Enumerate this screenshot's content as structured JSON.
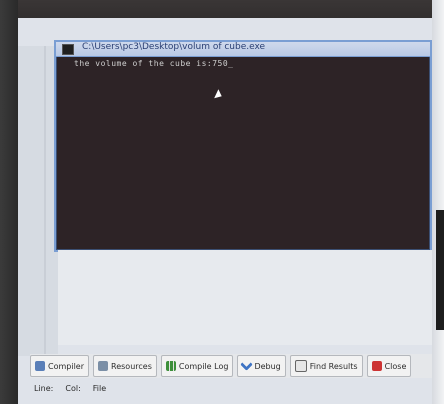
{
  "console": {
    "title": "C:\\Users\\pc3\\Desktop\\volum of cube.exe",
    "output": "the volume of the cube is:750_"
  },
  "tabs": [
    {
      "label": "Compiler",
      "icon": "compiler-icon"
    },
    {
      "label": "Resources",
      "icon": "resources-icon"
    },
    {
      "label": "Compile Log",
      "icon": "compile-log-icon"
    },
    {
      "label": "Debug",
      "icon": "debug-icon"
    },
    {
      "label": "Find Results",
      "icon": "find-results-icon"
    },
    {
      "label": "Close",
      "icon": "close-icon"
    }
  ],
  "status": {
    "line_label": "Line:",
    "col_label": "Col:",
    "file_label": "File"
  }
}
